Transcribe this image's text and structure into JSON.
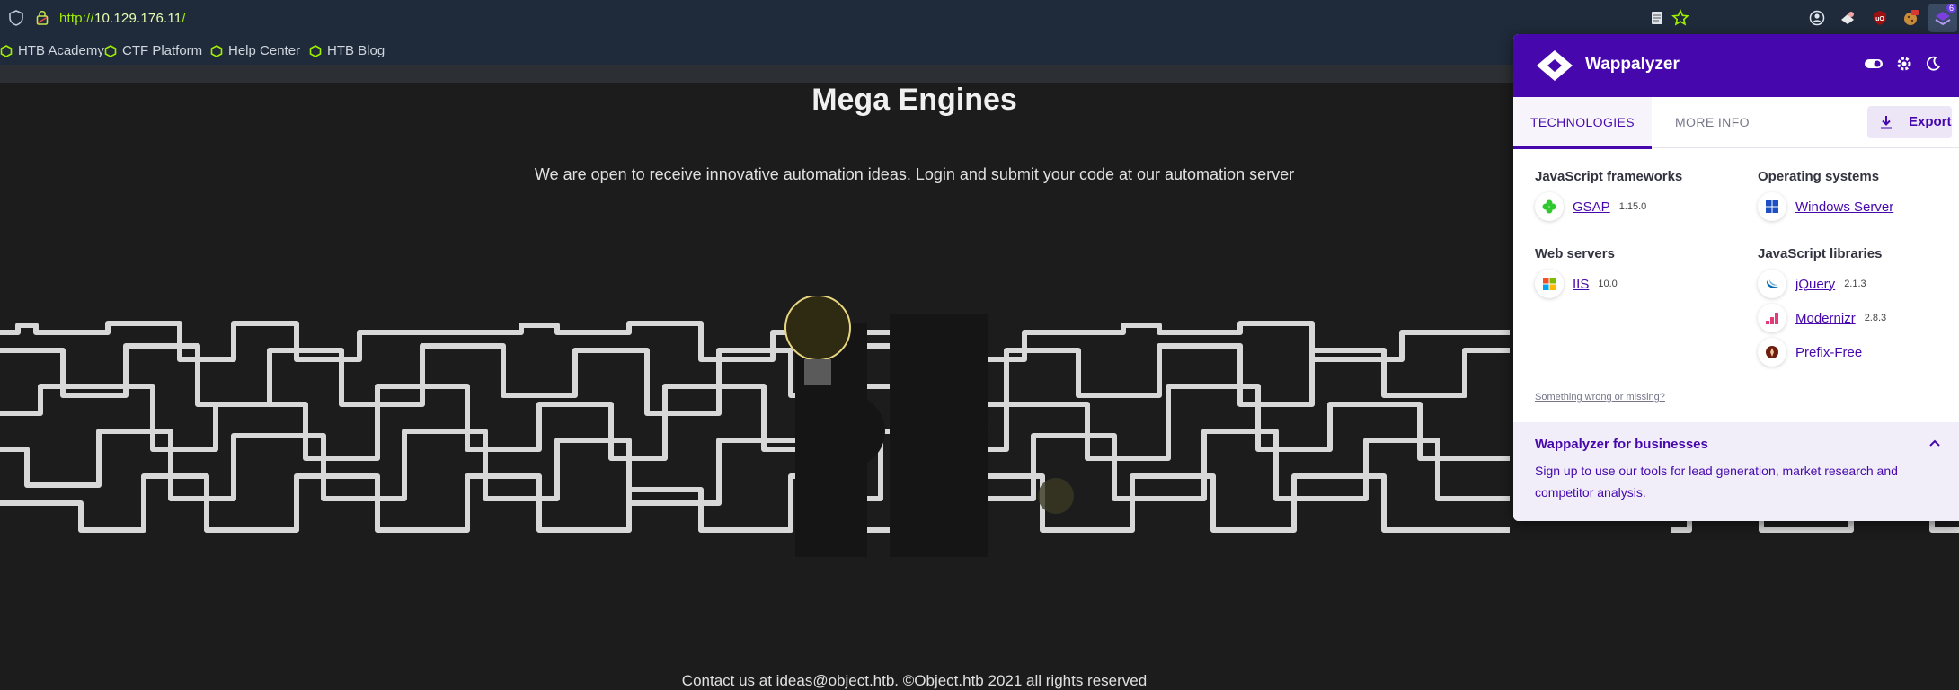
{
  "browser": {
    "url_scheme": "http://",
    "url_host": "10.129.176.11",
    "url_path": "/",
    "bookmarks": [
      "HTB Academy",
      "CTF Platform",
      "Help Center",
      "HTB Blog"
    ],
    "extension_badge": "6"
  },
  "page": {
    "title": "Mega Engines",
    "intro_before": "We are open to receive innovative automation ideas. Login and submit your code at our ",
    "intro_link": "automation",
    "intro_after": " server",
    "footer": "Contact us at ideas@object.htb. ©Object.htb 2021 all rights reserved"
  },
  "wappalyzer": {
    "brand": "Wappalyzer",
    "tabs": [
      "TECHNOLOGIES",
      "MORE INFO"
    ],
    "export_label": "Export",
    "categories": [
      {
        "title": "JavaScript frameworks",
        "items": [
          {
            "name": "GSAP",
            "version": "1.15.0",
            "icon": "gsap-icon"
          }
        ]
      },
      {
        "title": "Web servers",
        "items": [
          {
            "name": "IIS",
            "version": "10.0",
            "icon": "windows-icon"
          }
        ]
      },
      {
        "title": "Operating systems",
        "items": [
          {
            "name": "Windows Server",
            "version": "",
            "icon": "windows-server-icon"
          }
        ]
      },
      {
        "title": "JavaScript libraries",
        "items": [
          {
            "name": "jQuery",
            "version": "2.1.3",
            "icon": "jquery-icon"
          },
          {
            "name": "Modernizr",
            "version": "2.8.3",
            "icon": "modernizr-icon"
          },
          {
            "name": "Prefix-Free",
            "version": "",
            "icon": "prefix-free-icon"
          }
        ]
      }
    ],
    "wrong_link": "Something wrong or missing?",
    "business_title": "Wappalyzer for businesses",
    "business_text": "Sign up to use our tools for lead generation, market research and competitor analysis.",
    "colors": {
      "brand_purple": "#4608ad",
      "url_green": "#9fef00"
    }
  }
}
